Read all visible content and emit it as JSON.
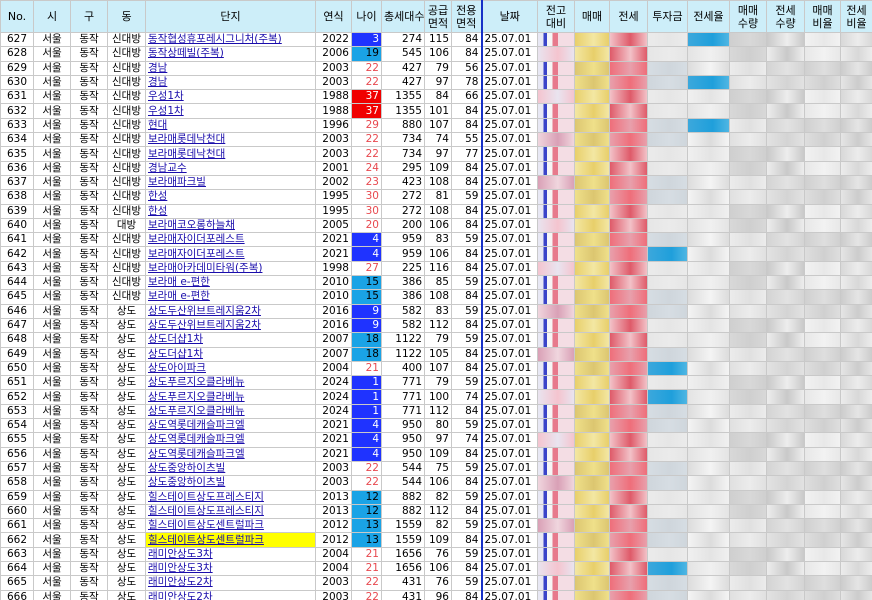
{
  "headers": [
    "No.",
    "시",
    "구",
    "동",
    "단지",
    "연식",
    "나이",
    "총세대수",
    "공급\n면적",
    "전용\n면적",
    "날짜",
    "전고\n대비",
    "매매",
    "전세",
    "투자금",
    "전세율",
    "매매\n수량",
    "전세\n수량",
    "매매\n비율",
    "전세\n비율"
  ],
  "colors": {
    "header_bg": "#cdeef9",
    "link": "#1a0dab",
    "age_text": "#e8494f",
    "age_blue": "#1aa3e6",
    "age_navy": "#1f33ff",
    "age_red": "#f00000",
    "highlight": "#ffff00"
  },
  "rows": [
    {
      "no": "627",
      "si": "서울",
      "gu": "동작",
      "dong": "신대방",
      "name": "동작협성휴포레시그니처(주복)",
      "year": "2022",
      "age": "3",
      "units": "274",
      "supply": "115",
      "area": "84",
      "date": "25.07.01"
    },
    {
      "no": "628",
      "si": "서울",
      "gu": "동작",
      "dong": "신대방",
      "name": "동작상떼빌(주복)",
      "year": "2006",
      "age": "19",
      "units": "545",
      "supply": "106",
      "area": "84",
      "date": "25.07.01"
    },
    {
      "no": "629",
      "si": "서울",
      "gu": "동작",
      "dong": "신대방",
      "name": "경남",
      "year": "2003",
      "age": "22",
      "units": "427",
      "supply": "79",
      "area": "56",
      "date": "25.07.01"
    },
    {
      "no": "630",
      "si": "서울",
      "gu": "동작",
      "dong": "신대방",
      "name": "경남",
      "year": "2003",
      "age": "22",
      "units": "427",
      "supply": "97",
      "area": "78",
      "date": "25.07.01"
    },
    {
      "no": "631",
      "si": "서울",
      "gu": "동작",
      "dong": "신대방",
      "name": "우성1차",
      "year": "1988",
      "age": "37",
      "units": "1355",
      "supply": "84",
      "area": "66",
      "date": "25.07.01"
    },
    {
      "no": "632",
      "si": "서울",
      "gu": "동작",
      "dong": "신대방",
      "name": "우성1차",
      "year": "1988",
      "age": "37",
      "units": "1355",
      "supply": "101",
      "area": "84",
      "date": "25.07.01"
    },
    {
      "no": "633",
      "si": "서울",
      "gu": "동작",
      "dong": "신대방",
      "name": "현대",
      "year": "1996",
      "age": "29",
      "units": "880",
      "supply": "107",
      "area": "84",
      "date": "25.07.01"
    },
    {
      "no": "634",
      "si": "서울",
      "gu": "동작",
      "dong": "신대방",
      "name": "보라매롯데낙천대",
      "year": "2003",
      "age": "22",
      "units": "734",
      "supply": "74",
      "area": "55",
      "date": "25.07.01"
    },
    {
      "no": "635",
      "si": "서울",
      "gu": "동작",
      "dong": "신대방",
      "name": "보라매롯데낙천대",
      "year": "2003",
      "age": "22",
      "units": "734",
      "supply": "97",
      "area": "77",
      "date": "25.07.01"
    },
    {
      "no": "636",
      "si": "서울",
      "gu": "동작",
      "dong": "신대방",
      "name": "경남교수",
      "year": "2001",
      "age": "24",
      "units": "295",
      "supply": "109",
      "area": "84",
      "date": "25.07.01"
    },
    {
      "no": "637",
      "si": "서울",
      "gu": "동작",
      "dong": "신대방",
      "name": "보라매파크빌",
      "year": "2002",
      "age": "23",
      "units": "423",
      "supply": "108",
      "area": "84",
      "date": "25.07.01"
    },
    {
      "no": "638",
      "si": "서울",
      "gu": "동작",
      "dong": "신대방",
      "name": "한성",
      "year": "1995",
      "age": "30",
      "units": "272",
      "supply": "81",
      "area": "59",
      "date": "25.07.01"
    },
    {
      "no": "639",
      "si": "서울",
      "gu": "동작",
      "dong": "신대방",
      "name": "한성",
      "year": "1995",
      "age": "30",
      "units": "272",
      "supply": "108",
      "area": "84",
      "date": "25.07.01"
    },
    {
      "no": "640",
      "si": "서울",
      "gu": "동작",
      "dong": "대방",
      "name": "보라매코오롱하늘채",
      "year": "2005",
      "age": "20",
      "units": "200",
      "supply": "106",
      "area": "84",
      "date": "25.07.01"
    },
    {
      "no": "641",
      "si": "서울",
      "gu": "동작",
      "dong": "신대방",
      "name": "보라매자이더포레스트",
      "year": "2021",
      "age": "4",
      "units": "959",
      "supply": "83",
      "area": "59",
      "date": "25.07.01"
    },
    {
      "no": "642",
      "si": "서울",
      "gu": "동작",
      "dong": "신대방",
      "name": "보라매자이더포레스트",
      "year": "2021",
      "age": "4",
      "units": "959",
      "supply": "106",
      "area": "84",
      "date": "25.07.01"
    },
    {
      "no": "643",
      "si": "서울",
      "gu": "동작",
      "dong": "신대방",
      "name": "보라매아카데미타워(주복)",
      "year": "1998",
      "age": "27",
      "units": "225",
      "supply": "116",
      "area": "84",
      "date": "25.07.01"
    },
    {
      "no": "644",
      "si": "서울",
      "gu": "동작",
      "dong": "신대방",
      "name": "보라매 e-편한",
      "year": "2010",
      "age": "15",
      "units": "386",
      "supply": "85",
      "area": "59",
      "date": "25.07.01"
    },
    {
      "no": "645",
      "si": "서울",
      "gu": "동작",
      "dong": "신대방",
      "name": "보라매 e-편한",
      "year": "2010",
      "age": "15",
      "units": "386",
      "supply": "108",
      "area": "84",
      "date": "25.07.01"
    },
    {
      "no": "646",
      "si": "서울",
      "gu": "동작",
      "dong": "상도",
      "name": "상도두산위브트레지움2차",
      "year": "2016",
      "age": "9",
      "units": "582",
      "supply": "83",
      "area": "59",
      "date": "25.07.01"
    },
    {
      "no": "647",
      "si": "서울",
      "gu": "동작",
      "dong": "상도",
      "name": "상도두산위브트레지움2차",
      "year": "2016",
      "age": "9",
      "units": "582",
      "supply": "112",
      "area": "84",
      "date": "25.07.01"
    },
    {
      "no": "648",
      "si": "서울",
      "gu": "동작",
      "dong": "상도",
      "name": "상도더샵1차",
      "year": "2007",
      "age": "18",
      "units": "1122",
      "supply": "79",
      "area": "59",
      "date": "25.07.01"
    },
    {
      "no": "649",
      "si": "서울",
      "gu": "동작",
      "dong": "상도",
      "name": "상도더샵1차",
      "year": "2007",
      "age": "18",
      "units": "1122",
      "supply": "105",
      "area": "84",
      "date": "25.07.01"
    },
    {
      "no": "650",
      "si": "서울",
      "gu": "동작",
      "dong": "상도",
      "name": "상도아이파크",
      "year": "2004",
      "age": "21",
      "units": "400",
      "supply": "107",
      "area": "84",
      "date": "25.07.01"
    },
    {
      "no": "651",
      "si": "서울",
      "gu": "동작",
      "dong": "상도",
      "name": "상도푸르지오클라베뉴",
      "year": "2024",
      "age": "1",
      "units": "771",
      "supply": "79",
      "area": "59",
      "date": "25.07.01"
    },
    {
      "no": "652",
      "si": "서울",
      "gu": "동작",
      "dong": "상도",
      "name": "상도푸르지오클라베뉴",
      "year": "2024",
      "age": "1",
      "units": "771",
      "supply": "100",
      "area": "74",
      "date": "25.07.01"
    },
    {
      "no": "653",
      "si": "서울",
      "gu": "동작",
      "dong": "상도",
      "name": "상도푸르지오클라베뉴",
      "year": "2024",
      "age": "1",
      "units": "771",
      "supply": "112",
      "area": "84",
      "date": "25.07.01"
    },
    {
      "no": "654",
      "si": "서울",
      "gu": "동작",
      "dong": "상도",
      "name": "상도역롯데캐슬파크엘",
      "year": "2021",
      "age": "4",
      "units": "950",
      "supply": "80",
      "area": "59",
      "date": "25.07.01"
    },
    {
      "no": "655",
      "si": "서울",
      "gu": "동작",
      "dong": "상도",
      "name": "상도역롯데캐슬파크엘",
      "year": "2021",
      "age": "4",
      "units": "950",
      "supply": "97",
      "area": "74",
      "date": "25.07.01"
    },
    {
      "no": "656",
      "si": "서울",
      "gu": "동작",
      "dong": "상도",
      "name": "상도역롯데캐슬파크엘",
      "year": "2021",
      "age": "4",
      "units": "950",
      "supply": "109",
      "area": "84",
      "date": "25.07.01"
    },
    {
      "no": "657",
      "si": "서울",
      "gu": "동작",
      "dong": "상도",
      "name": "상도중앙하이츠빌",
      "year": "2003",
      "age": "22",
      "units": "544",
      "supply": "75",
      "area": "59",
      "date": "25.07.01"
    },
    {
      "no": "658",
      "si": "서울",
      "gu": "동작",
      "dong": "상도",
      "name": "상도중앙하이츠빌",
      "year": "2003",
      "age": "22",
      "units": "544",
      "supply": "106",
      "area": "84",
      "date": "25.07.01"
    },
    {
      "no": "659",
      "si": "서울",
      "gu": "동작",
      "dong": "상도",
      "name": "힐스테이트상도프레스티지",
      "year": "2013",
      "age": "12",
      "units": "882",
      "supply": "82",
      "area": "59",
      "date": "25.07.01"
    },
    {
      "no": "660",
      "si": "서울",
      "gu": "동작",
      "dong": "상도",
      "name": "힐스테이트상도프레스티지",
      "year": "2013",
      "age": "12",
      "units": "882",
      "supply": "112",
      "area": "84",
      "date": "25.07.01"
    },
    {
      "no": "661",
      "si": "서울",
      "gu": "동작",
      "dong": "상도",
      "name": "힐스테이트상도센트럴파크",
      "year": "2012",
      "age": "13",
      "units": "1559",
      "supply": "82",
      "area": "59",
      "date": "25.07.01"
    },
    {
      "no": "662",
      "si": "서울",
      "gu": "동작",
      "dong": "상도",
      "name": "힐스테이트상도센트럴파크",
      "year": "2012",
      "age": "13",
      "units": "1559",
      "supply": "109",
      "area": "84",
      "date": "25.07.01"
    },
    {
      "no": "663",
      "si": "서울",
      "gu": "동작",
      "dong": "상도",
      "name": "래미안상도3차",
      "year": "2004",
      "age": "21",
      "units": "1656",
      "supply": "76",
      "area": "59",
      "date": "25.07.01"
    },
    {
      "no": "664",
      "si": "서울",
      "gu": "동작",
      "dong": "상도",
      "name": "래미안상도3차",
      "year": "2004",
      "age": "21",
      "units": "1656",
      "supply": "106",
      "area": "84",
      "date": "25.07.01"
    },
    {
      "no": "665",
      "si": "서울",
      "gu": "동작",
      "dong": "상도",
      "name": "래미안상도2차",
      "year": "2003",
      "age": "22",
      "units": "431",
      "supply": "76",
      "area": "59",
      "date": "25.07.01"
    },
    {
      "no": "666",
      "si": "서울",
      "gu": "동작",
      "dong": "상도",
      "name": "래미안상도2차",
      "year": "2003",
      "age": "22",
      "units": "431",
      "supply": "96",
      "area": "84",
      "date": "25.07.01"
    }
  ]
}
